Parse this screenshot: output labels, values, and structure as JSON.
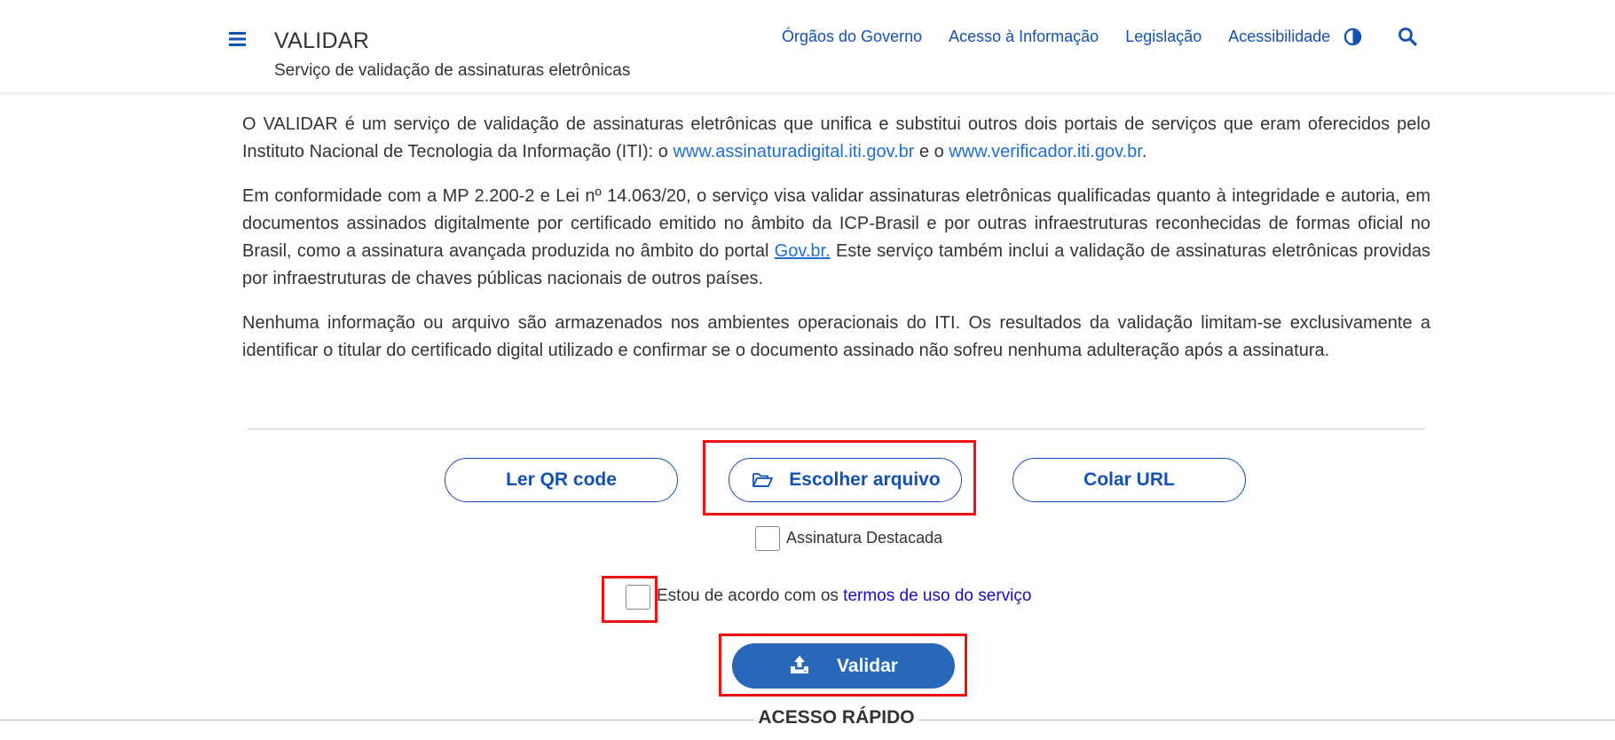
{
  "header": {
    "title": "VALIDAR",
    "subtitle": "Serviço de validação de assinaturas eletrônicas",
    "nav": [
      {
        "label": "Órgãos do Governo"
      },
      {
        "label": "Acesso à Informação"
      },
      {
        "label": "Legislação"
      },
      {
        "label": "Acessibilidade"
      }
    ],
    "icons": {
      "menu": "menu-icon",
      "contrast": "contrast-icon",
      "search": "search-icon"
    }
  },
  "intro": {
    "p1_text": "O VALIDAR é um serviço de validação de assinaturas eletrônicas que unifica e substitui outros dois portais de serviços que eram oferecidos pelo Instituto Nacional de Tecnologia da Informação (ITI): o ",
    "p1_link1": "www.assinaturadigital.iti.gov.br",
    "p1_mid": " e o ",
    "p1_link2": "www.verificador.iti.gov.br",
    "p1_end": ".",
    "p2_text": "Em conformidade com a MP 2.200-2 e Lei nº 14.063/20, o serviço visa validar assinaturas eletrônicas qualificadas quanto à integridade e autoria, em documentos assinados digitalmente por certificado emitido no âmbito da ICP-Brasil e por outras infraestruturas reconhecidas de formas oficial no Brasil, como a assinatura avançada produzida no âmbito do portal ",
    "p2_link": "Gov.br.",
    "p2_end": " Este serviço também inclui a validação de assinaturas eletrônicas providas por infraestruturas de chaves públicas nacionais de outros países.",
    "p3_text": "Nenhuma informação ou arquivo são armazenados nos ambientes operacionais do ITI. Os resultados da validação limitam-se exclusivamente a identificar o titular do certificado digital utilizado e confirmar se o documento assinado não sofreu nenhuma adulteração após a assinatura."
  },
  "actions": {
    "qr_label": "Ler QR code",
    "file_label": "Escolher arquivo",
    "url_label": "Colar URL",
    "detached_label": "Assinatura Destacada",
    "terms_prefix": "Estou de acordo com os ",
    "terms_link": "termos de uso do serviço",
    "validate_label": "Validar"
  },
  "footer": {
    "title": "ACESSO RÁPIDO"
  },
  "colors": {
    "primary": "#1351b4",
    "validate_bg": "#2968b8",
    "link": "#1f6ed4",
    "highlight": "#ee1111"
  }
}
